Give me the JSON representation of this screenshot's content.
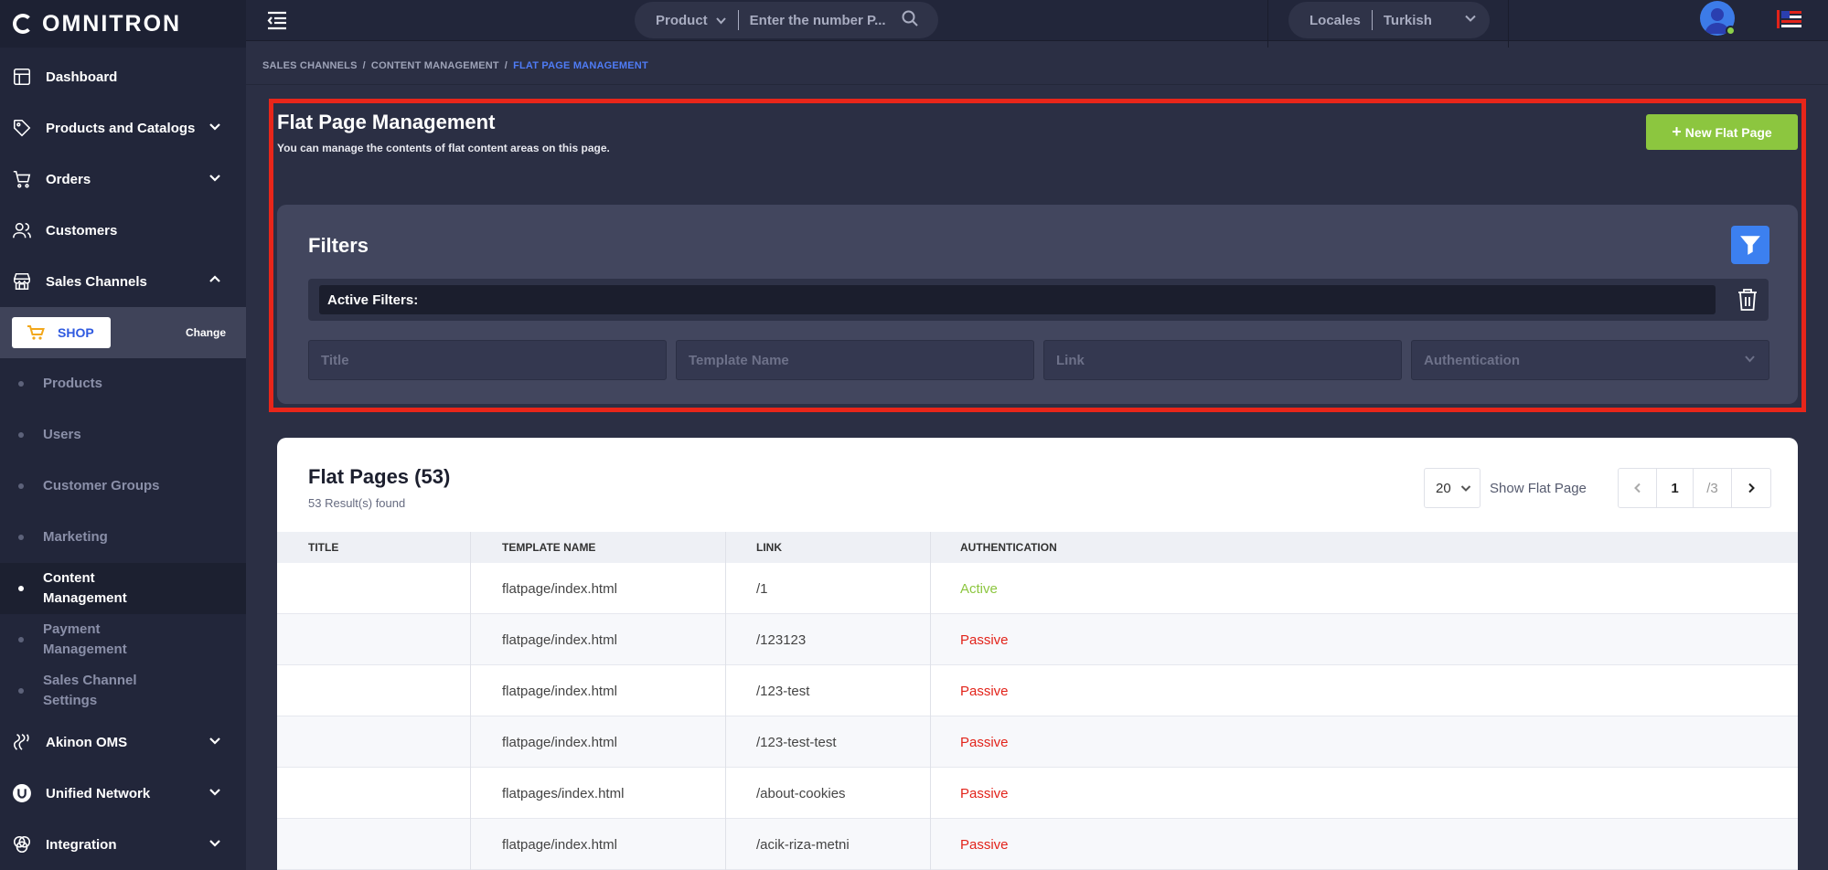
{
  "brand": {
    "name": "OMNITRON"
  },
  "topbar": {
    "search_type": "Product",
    "search_placeholder": "Enter the number P...",
    "locales_label": "Locales",
    "locale_value": "Turkish"
  },
  "sidebar": {
    "items_top": [
      {
        "label": "Dashboard",
        "icon": "dashboard-icon"
      },
      {
        "label": "Products and Catalogs",
        "icon": "tag-icon"
      },
      {
        "label": "Orders",
        "icon": "cart-icon"
      },
      {
        "label": "Customers",
        "icon": "users-icon"
      },
      {
        "label": "Sales Channels",
        "icon": "store-icon"
      }
    ],
    "shop_label": "SHOP",
    "change_label": "Change",
    "sub_items": [
      {
        "label": "Products"
      },
      {
        "label": "Users"
      },
      {
        "label": "Customer Groups"
      },
      {
        "label": "Marketing"
      },
      {
        "label": "Content Management"
      },
      {
        "label": "Payment Management"
      },
      {
        "label": "Sales Channel Settings"
      }
    ],
    "items_bottom": [
      {
        "label": "Akinon OMS",
        "icon": "oms-icon"
      },
      {
        "label": "Unified Network",
        "icon": "network-icon"
      },
      {
        "label": "Integration",
        "icon": "integration-icon"
      }
    ]
  },
  "breadcrumb": {
    "items": [
      "SALES CHANNELS",
      "CONTENT MANAGEMENT",
      "FLAT PAGE MANAGEMENT"
    ]
  },
  "header": {
    "title": "Flat Page Management",
    "subtitle": "You can manage the contents of flat content areas on this page.",
    "new_button": "New Flat Page"
  },
  "filters": {
    "title": "Filters",
    "active_label": "Active Filters:",
    "title_placeholder": "Title",
    "template_placeholder": "Template Name",
    "link_placeholder": "Link",
    "auth_placeholder": "Authentication"
  },
  "table": {
    "title": "Flat Pages (53)",
    "result_text": "53 Result(s) found",
    "page_size": "20",
    "show_label": "Show Flat Page",
    "current_page": "1",
    "total_pages": "/3",
    "columns": [
      "TITLE",
      "TEMPLATE NAME",
      "LINK",
      "AUTHENTICATION"
    ],
    "rows": [
      {
        "title": "",
        "template": "flatpage/index.html",
        "link": "/1",
        "auth": "Active"
      },
      {
        "title": "",
        "template": "flatpage/index.html",
        "link": "/123123",
        "auth": "Passive"
      },
      {
        "title": "",
        "template": "flatpage/index.html",
        "link": "/123-test",
        "auth": "Passive"
      },
      {
        "title": "",
        "template": "flatpage/index.html",
        "link": "/123-test-test",
        "auth": "Passive"
      },
      {
        "title": "",
        "template": "flatpages/index.html",
        "link": "/about-cookies",
        "auth": "Passive"
      },
      {
        "title": "",
        "template": "flatpage/index.html",
        "link": "/acik-riza-metni",
        "auth": "Passive"
      }
    ]
  },
  "colors": {
    "accent_green": "#8cc63f",
    "accent_blue": "#3c80f0",
    "passive_red": "#e2231a",
    "highlight_red": "#e8261a"
  }
}
